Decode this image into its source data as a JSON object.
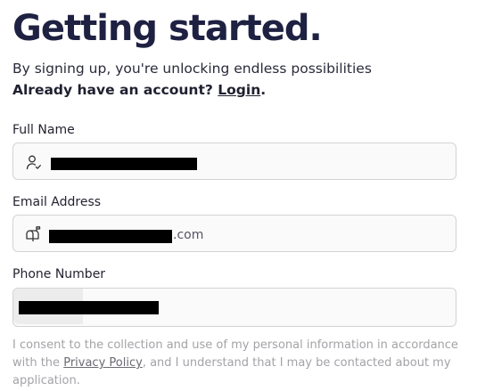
{
  "header": {
    "title": "Getting started.",
    "subtitle": "By signing up, you're unlocking endless possibilities",
    "login_prompt": "Already have an account?",
    "login_link": "Login",
    "login_suffix": "."
  },
  "form": {
    "full_name": {
      "label": "Full Name",
      "icon": "user-icon",
      "value": "[redacted]"
    },
    "email": {
      "label": "Email Address",
      "icon": "mailbox-icon",
      "value_suffix": ".com"
    },
    "phone": {
      "label": "Phone Number",
      "value": "[redacted]"
    }
  },
  "consent": {
    "text_before": "I consent to the collection and use of my personal information in accordance with the",
    "link": "Privacy Policy",
    "text_after": ", and I understand that I may be contacted about my application."
  }
}
